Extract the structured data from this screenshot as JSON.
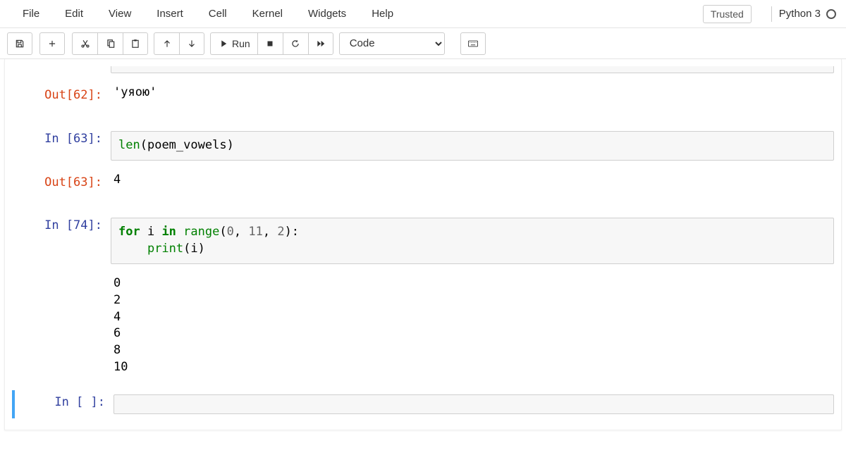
{
  "menubar": {
    "items": [
      "File",
      "Edit",
      "View",
      "Insert",
      "Cell",
      "Kernel",
      "Widgets",
      "Help"
    ],
    "trusted": "Trusted",
    "kernel": "Python 3"
  },
  "toolbar": {
    "run_label": "Run",
    "celltype_selected": "Code"
  },
  "cells": [
    {
      "out_prompt": "Out[62]:",
      "out_text": "'уяою'"
    },
    {
      "in_prompt": "In [63]:",
      "code_tokens": [
        {
          "t": "len",
          "c": "bi"
        },
        {
          "t": "(",
          "c": "nm"
        },
        {
          "t": "poem_vowels",
          "c": "nm"
        },
        {
          "t": ")",
          "c": "nm"
        }
      ],
      "out_prompt": "Out[63]:",
      "out_text": "4"
    },
    {
      "in_prompt": "In [74]:",
      "code_lines": [
        [
          {
            "t": "for",
            "c": "kw"
          },
          {
            "t": " i ",
            "c": "nm"
          },
          {
            "t": "in",
            "c": "kw"
          },
          {
            "t": " ",
            "c": "nm"
          },
          {
            "t": "range",
            "c": "bi"
          },
          {
            "t": "(",
            "c": "nm"
          },
          {
            "t": "0",
            "c": "num"
          },
          {
            "t": ", ",
            "c": "nm"
          },
          {
            "t": "11",
            "c": "num"
          },
          {
            "t": ", ",
            "c": "nm"
          },
          {
            "t": "2",
            "c": "num"
          },
          {
            "t": "):",
            "c": "nm"
          }
        ],
        [
          {
            "t": "    ",
            "c": "nm"
          },
          {
            "t": "print",
            "c": "bi"
          },
          {
            "t": "(i)",
            "c": "nm"
          }
        ]
      ],
      "stdout": "0\n2\n4\n6\n8\n10"
    },
    {
      "in_prompt": "In [ ]:",
      "code": ""
    }
  ]
}
